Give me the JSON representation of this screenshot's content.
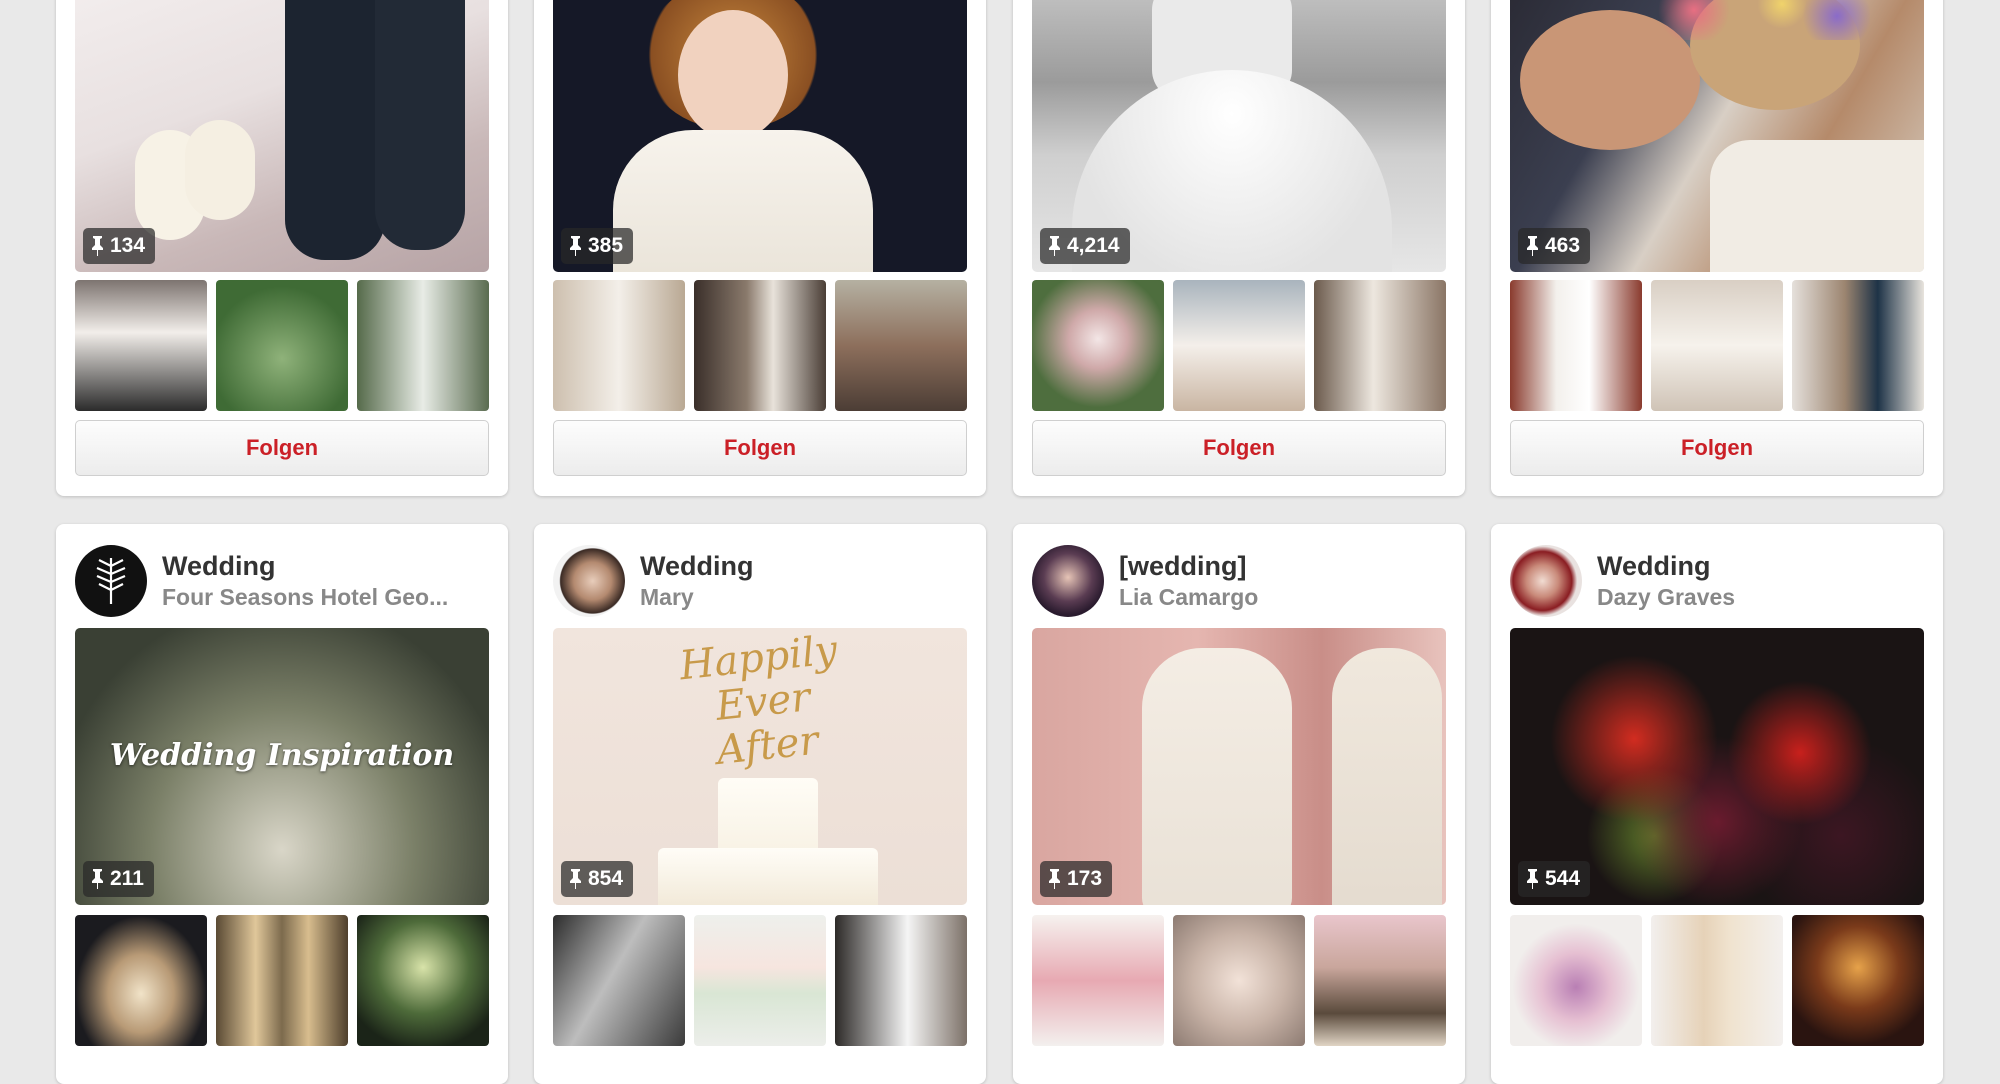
{
  "colors": {
    "accent": "#cb2027",
    "page_bg": "#e9e9e9"
  },
  "follow_label": "Folgen",
  "top_row": [
    {
      "pin_count": "134"
    },
    {
      "pin_count": "385"
    },
    {
      "pin_count": "4,214"
    },
    {
      "pin_count": "463"
    }
  ],
  "bottom_row": [
    {
      "title": "Wedding",
      "owner": "Four Seasons Hotel Geo...",
      "pin_count": "211",
      "image_text": "Wedding Inspiration"
    },
    {
      "title": "Wedding",
      "owner": "Mary",
      "pin_count": "854",
      "image_text": "Happily Ever After"
    },
    {
      "title": "[wedding]",
      "owner": "Lia Camargo",
      "pin_count": "173"
    },
    {
      "title": "Wedding",
      "owner": "Dazy Graves",
      "pin_count": "544"
    }
  ],
  "icons": {
    "pin": "pushpin-icon"
  }
}
